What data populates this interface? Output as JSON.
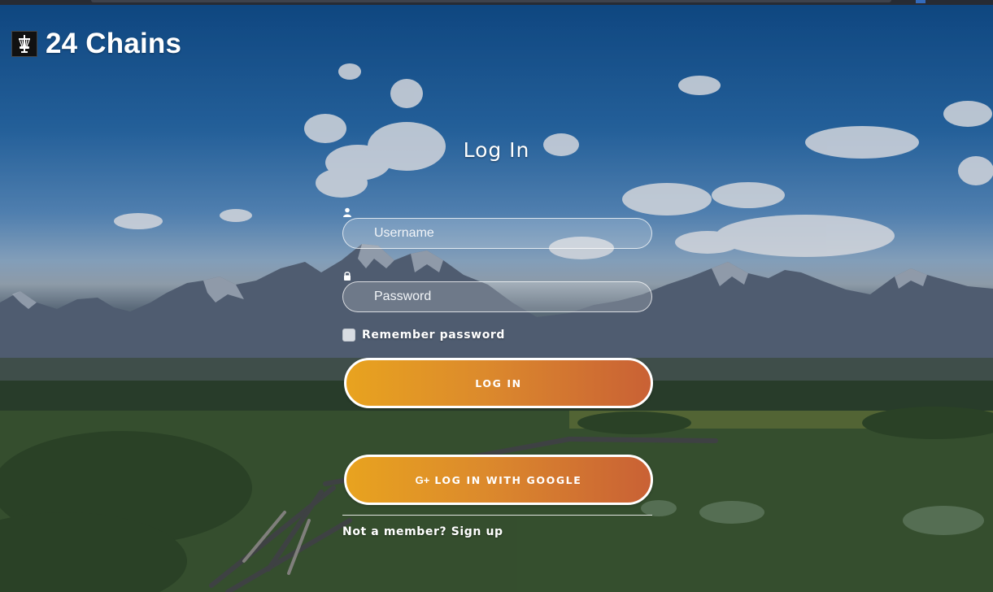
{
  "brand": {
    "name": "24 Chains",
    "logo_icon": "disc-golf-basket-icon"
  },
  "login": {
    "title": "Log In",
    "username": {
      "icon": "user-icon",
      "placeholder": "Username",
      "value": ""
    },
    "password": {
      "icon": "lock-icon",
      "placeholder": "Password",
      "value": ""
    },
    "remember": {
      "label": "Remember password",
      "checked": false
    },
    "login_button": "LOG IN",
    "google_button": {
      "icon": "google-plus-icon",
      "icon_text": "G+",
      "label": "LOG IN WITH GOOGLE"
    },
    "signup_link": "Not a member? Sign up"
  },
  "colors": {
    "button_gradient_start": "#e8a31f",
    "button_gradient_end": "#c96135",
    "text": "#ffffff"
  }
}
